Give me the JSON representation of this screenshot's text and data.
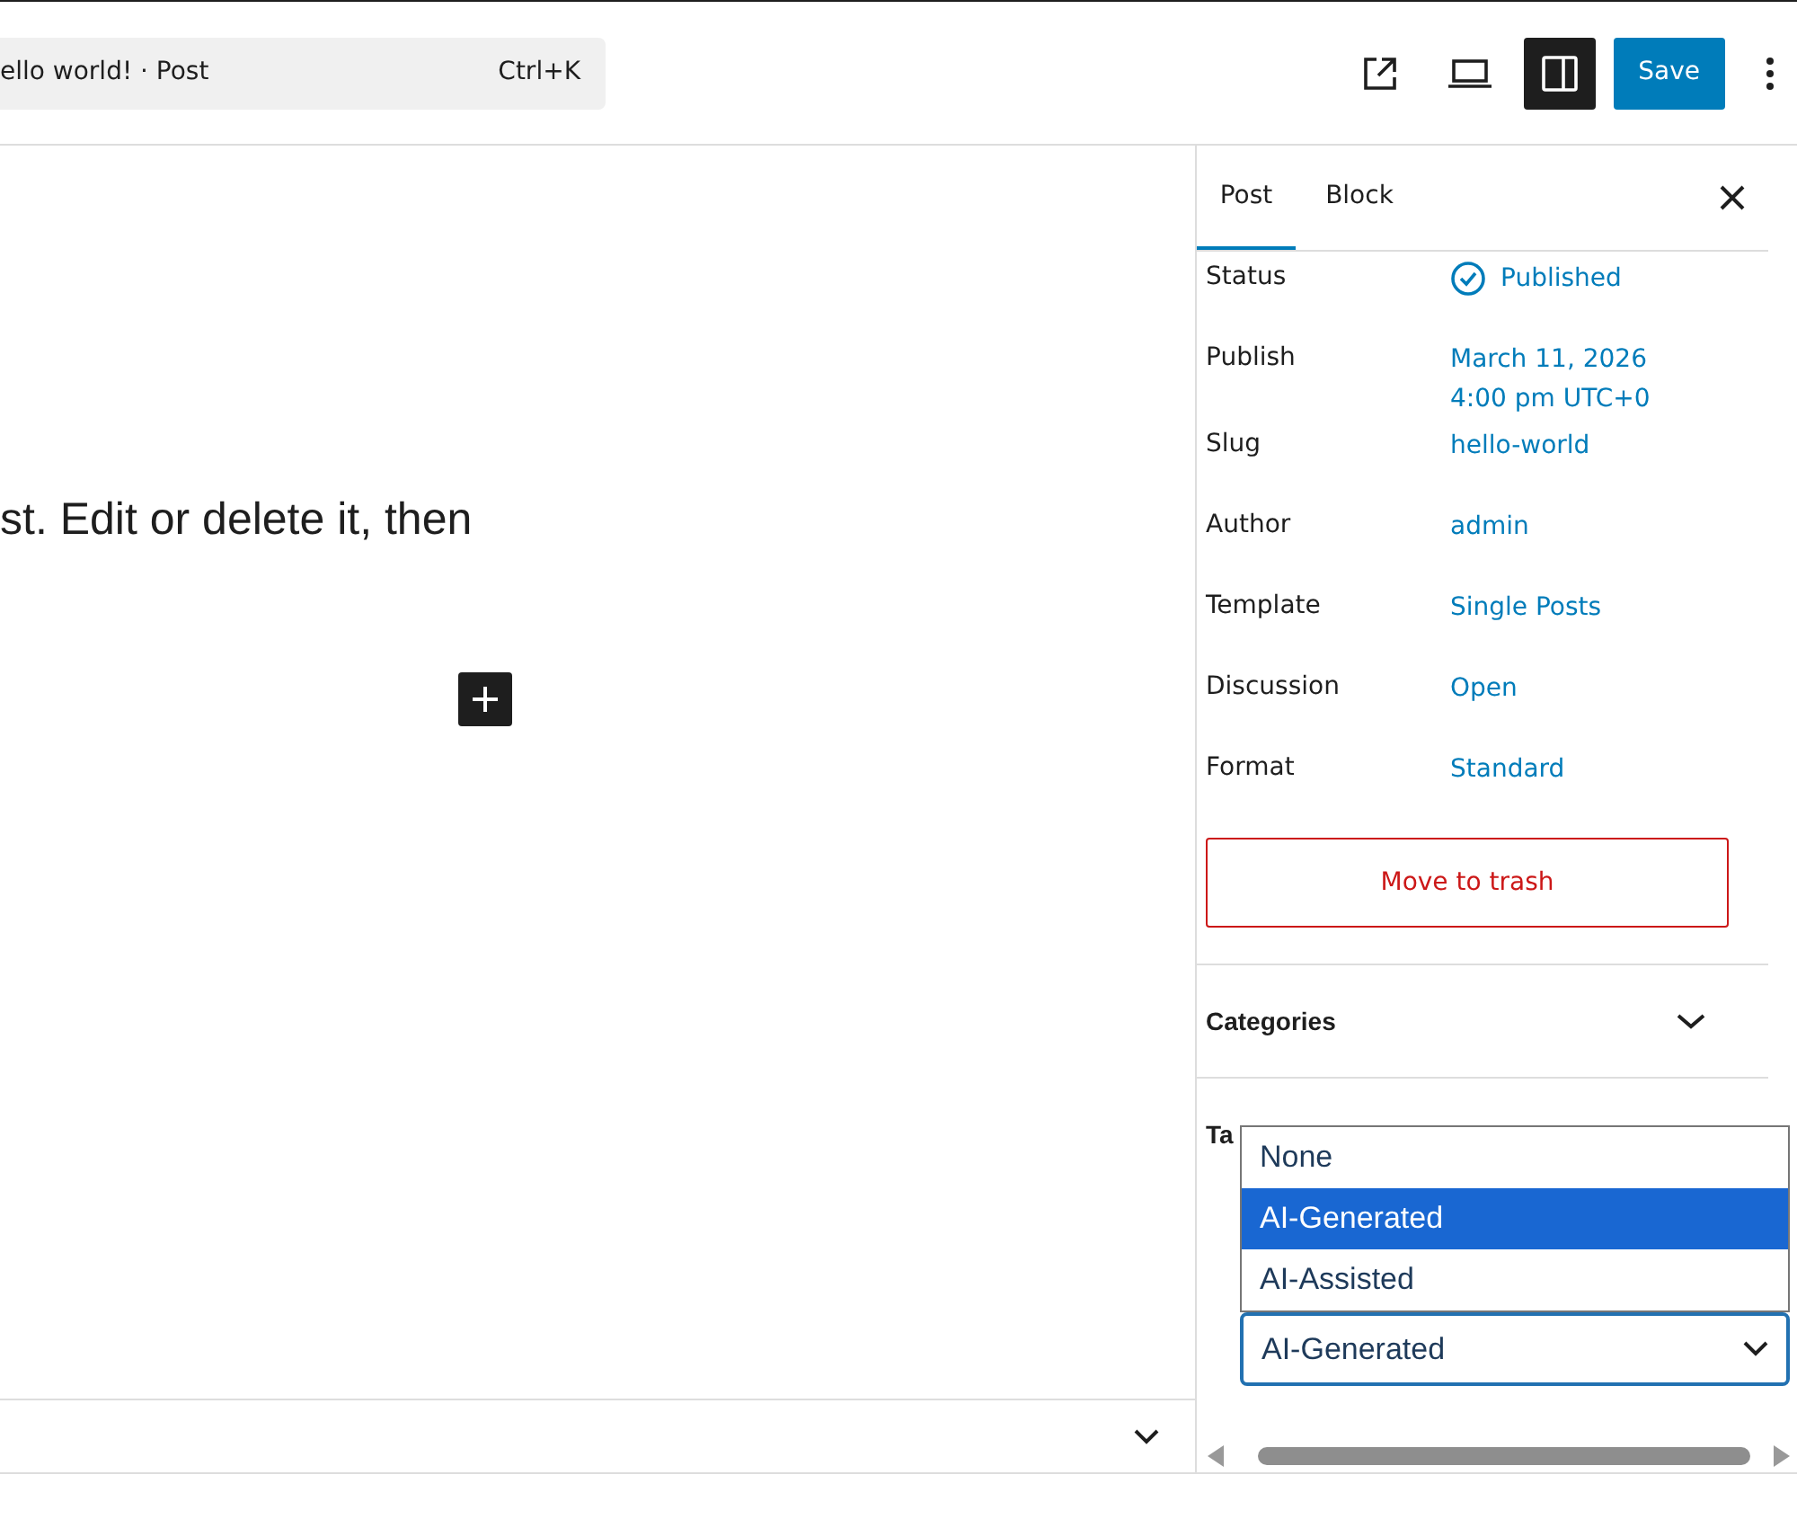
{
  "header": {
    "command_bar": {
      "title": "ello world! · Post",
      "shortcut": "Ctrl+K"
    },
    "sidebar_toggle": {
      "on": true
    },
    "save_button": "Save"
  },
  "editor": {
    "paragraph": "st. Edit or delete it, then"
  },
  "sidebar": {
    "tabs": [
      {
        "label": "Post",
        "selected": true
      },
      {
        "label": "Block",
        "selected": false
      }
    ],
    "rows": [
      {
        "label": "Status",
        "kind": "status",
        "values": [
          "Published"
        ]
      },
      {
        "label": "Publish",
        "kind": "link",
        "values": [
          "March 11, 2026",
          "4:00 pm UTC+0"
        ]
      },
      {
        "label": "Slug",
        "kind": "link",
        "values": [
          "hello-world"
        ]
      },
      {
        "label": "Author",
        "kind": "link",
        "values": [
          "admin"
        ]
      },
      {
        "label": "Template",
        "kind": "link",
        "values": [
          "Single Posts"
        ]
      },
      {
        "label": "Discussion",
        "kind": "link",
        "values": [
          "Open"
        ]
      },
      {
        "label": "Format",
        "kind": "link",
        "values": [
          "Standard"
        ]
      }
    ],
    "trash_button": "Move to trash",
    "panels": [
      {
        "title": "Categories",
        "expanded": false
      },
      {
        "title": "Ta"
      }
    ],
    "select": {
      "value": "AI-Generated",
      "open": true,
      "options": [
        {
          "label": "None",
          "selected": false
        },
        {
          "label": "AI-Generated",
          "selected": true
        },
        {
          "label": "AI-Assisted",
          "selected": false
        }
      ]
    }
  }
}
